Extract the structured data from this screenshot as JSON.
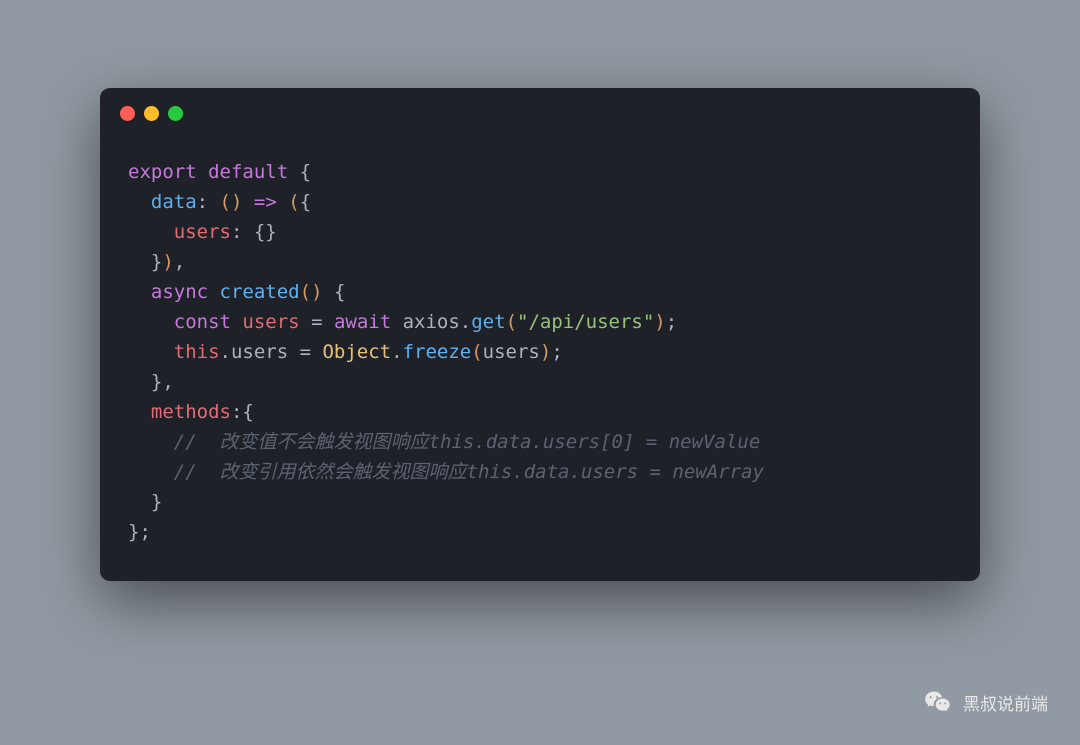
{
  "code": {
    "l1": {
      "t1": "export",
      "t2": "default",
      "t3": " {"
    },
    "l2": {
      "t1": "  ",
      "t2": "data",
      "t3": ": ",
      "t4": "(",
      "t5": ")",
      "t6": " ",
      "t7": "=>",
      "t8": " ",
      "t9": "(",
      "t10": "{"
    },
    "l3": {
      "t1": "    ",
      "t2": "users",
      "t3": ": {}"
    },
    "l4": {
      "t1": "  }",
      "t2": ")",
      "t3": ","
    },
    "l5": {
      "t1": "  ",
      "t2": "async",
      "t3": " ",
      "t4": "created",
      "t5": "(",
      "t6": ")",
      "t7": " {"
    },
    "l6": {
      "t1": "    ",
      "t2": "const",
      "t3": " ",
      "t4": "users",
      "t5": " = ",
      "t6": "await",
      "t7": " axios.",
      "t8": "get",
      "t9": "(",
      "t10": "\"/api/users\"",
      "t11": ")",
      "t12": ";"
    },
    "l7": {
      "t1": "    ",
      "t2": "this",
      "t3": ".users = ",
      "t4": "Object",
      "t5": ".",
      "t6": "freeze",
      "t7": "(",
      "t8": "users",
      "t9": ")",
      "t10": ";"
    },
    "l8": {
      "t1": "  },"
    },
    "l9": {
      "t1": "  ",
      "t2": "methods",
      "t3": ":{"
    },
    "l10": {
      "t1": "    ",
      "t2": "//  改变值不会触发视图响应this.data.users[0] = newValue"
    },
    "l11": {
      "t1": "    ",
      "t2": "//  改变引用依然会触发视图响应this.data.users = newArray"
    },
    "l12": {
      "t1": "  }"
    },
    "l13": {
      "t1": "};"
    }
  },
  "attribution": {
    "text": "黑叔说前端"
  },
  "colors": {
    "bg": "#919aa2",
    "window": "#1e2127",
    "keyword": "#c678dd",
    "default": "#d19a66",
    "property": "#e06c75",
    "function": "#61afef",
    "string": "#98c379",
    "object": "#e5c07b",
    "comment": "#5c6370",
    "text": "#abb2bf"
  }
}
